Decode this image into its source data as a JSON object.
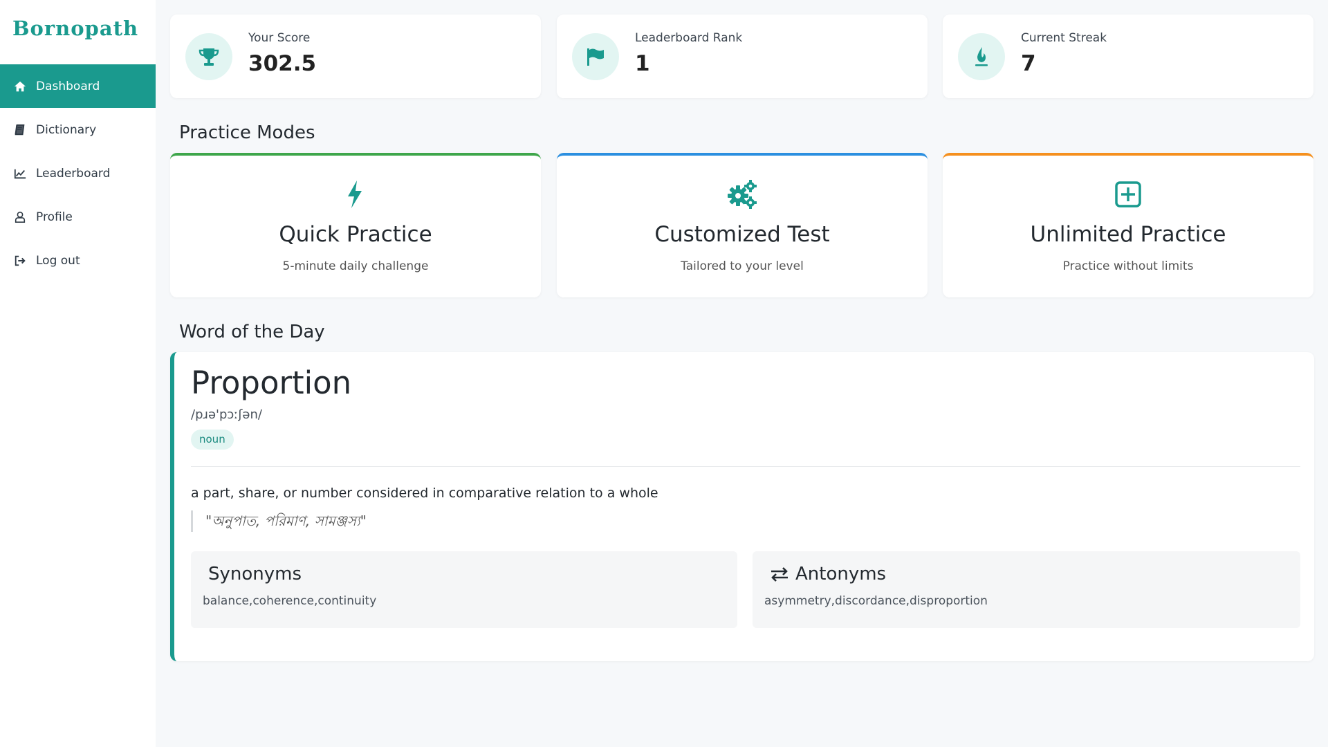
{
  "brand": {
    "name": "Bornopath",
    "accent": "#1a9a8e"
  },
  "sidebar": {
    "items": [
      {
        "label": "Dashboard",
        "icon": "home-icon",
        "active": true
      },
      {
        "label": "Dictionary",
        "icon": "book-icon"
      },
      {
        "label": "Leaderboard",
        "icon": "chart-line-icon"
      },
      {
        "label": "Profile",
        "icon": "user-icon"
      },
      {
        "label": "Log out",
        "icon": "sign-out-icon"
      }
    ]
  },
  "stats": {
    "score": {
      "label": "Your Score",
      "value": "302.5",
      "icon": "trophy-icon"
    },
    "rank": {
      "label": "Leaderboard Rank",
      "value": "1",
      "icon": "flag-icon"
    },
    "streak": {
      "label": "Current Streak",
      "value": "7",
      "icon": "fire-icon"
    }
  },
  "practice": {
    "title": "Practice Modes",
    "modes": [
      {
        "title": "Quick Practice",
        "subtitle": "5-minute daily challenge",
        "icon": "bolt-icon",
        "color": "#3ea64a"
      },
      {
        "title": "Customized Test",
        "subtitle": "Tailored to your level",
        "icon": "gears-icon",
        "color": "#2b8fe0"
      },
      {
        "title": "Unlimited Practice",
        "subtitle": "Practice without limits",
        "icon": "plus-square-icon",
        "color": "#f5901e"
      }
    ]
  },
  "word_of_day": {
    "title": "Word of the Day",
    "word": "Proportion",
    "phonetic": "/pɹə'pɔːʃən/",
    "part_of_speech": "noun",
    "definition": "a part, share, or number considered in comparative relation to a whole",
    "translation": "\"অনুপাত, পরিমাণ, সামঞ্জস্য\"",
    "synonyms": {
      "title": "Synonyms",
      "list": "balance,coherence,continuity"
    },
    "antonyms": {
      "title": "Antonyms",
      "list": "asymmetry,discordance,disproportion",
      "icon": "exchange-icon"
    }
  }
}
